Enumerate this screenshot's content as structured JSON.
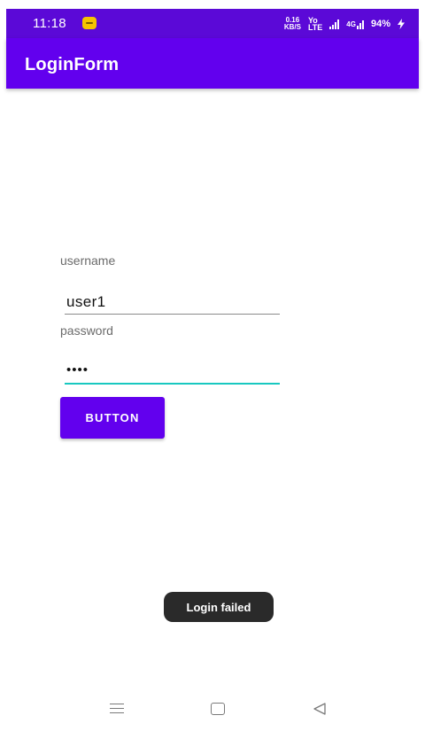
{
  "status_bar": {
    "time": "11:18",
    "net_speed_value": "0.16",
    "net_speed_unit": "KB/S",
    "volte_top": "Yo",
    "volte_bottom": "LTE",
    "network_4g": "4G",
    "battery": "94%"
  },
  "app_bar": {
    "title": "LoginForm"
  },
  "form": {
    "username_label": "username",
    "username_value": "user1",
    "password_label": "password",
    "password_masked": "••••",
    "button_label": "BUTTON"
  },
  "toast": {
    "message": "Login failed"
  },
  "colors": {
    "status_bar": "#5b09d7",
    "primary": "#6200ee",
    "accent": "#18c8c0",
    "toast_bg": "#2a2a2a"
  }
}
